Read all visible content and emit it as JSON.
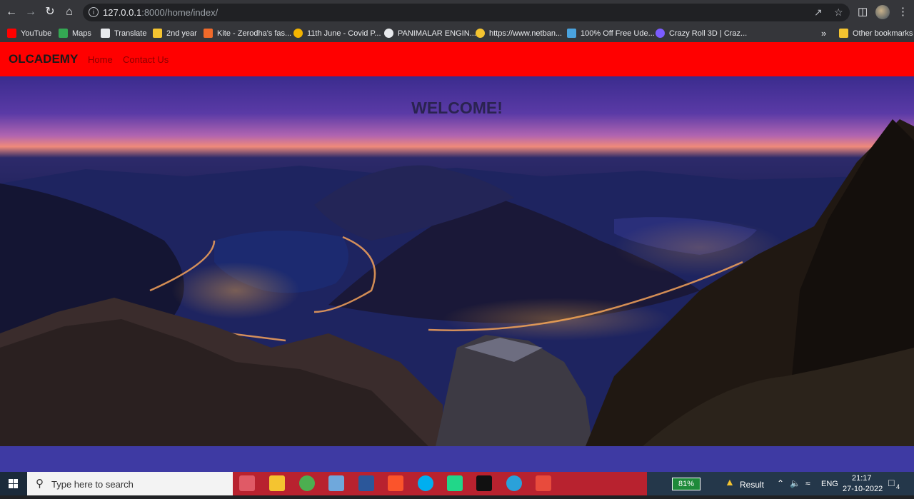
{
  "browser": {
    "url_host": "127.0.0.1",
    "url_rest": ":8000/home/index/",
    "bookmarks": [
      {
        "label": "YouTube",
        "color": "#ff0000"
      },
      {
        "label": "Maps",
        "color": "#34a853"
      },
      {
        "label": "Translate",
        "color": "#e8eaed"
      },
      {
        "label": "2nd year",
        "color": "#f4c430"
      },
      {
        "label": "Kite - Zerodha's fas...",
        "color": "#f06a2a"
      },
      {
        "label": "11th June - Covid P...",
        "color": "#f4b400"
      },
      {
        "label": "PANIMALAR ENGIN...",
        "color": "#e8eaed"
      },
      {
        "label": "https://www.netban...",
        "color": "#f4c430"
      },
      {
        "label": "100% Off Free Ude...",
        "color": "#4aa3df"
      },
      {
        "label": "Crazy Roll 3D | Craz...",
        "color": "#7b5cff"
      }
    ],
    "more_bookmarks": "»",
    "other_bookmarks": "Other bookmarks"
  },
  "site": {
    "brand": "OLCADEMY",
    "nav": [
      "Home",
      "Contact Us"
    ],
    "hero_title": "WELCOME!"
  },
  "taskbar": {
    "search_placeholder": "Type here to search",
    "battery": "81%",
    "result": "Result",
    "lang": "ENG",
    "time": "21:17",
    "date": "27-10-2022",
    "notifications": "4"
  }
}
